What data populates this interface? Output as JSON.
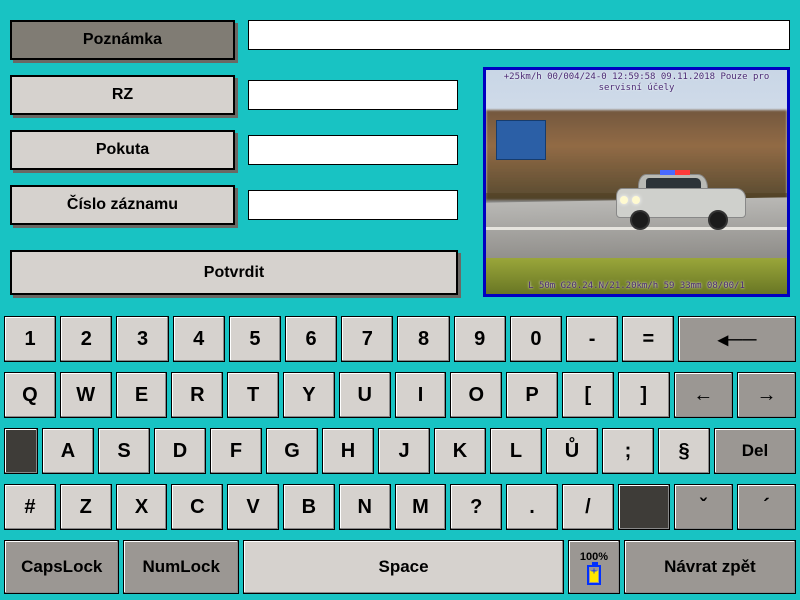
{
  "form": {
    "poznamka_label": "Poznámka",
    "rz_label": "RZ",
    "pokuta_label": "Pokuta",
    "cislo_zaznamu_label": "Číslo záznamu",
    "potvrdit_label": "Potvrdit",
    "poznamka_value": "",
    "rz_value": "",
    "pokuta_value": "",
    "cislo_zaznamu_value": ""
  },
  "photo": {
    "overlay_top": "+25km/h  00/004/24-0  12:59:58  09.11.2018\nPouze pro servisní účely",
    "overlay_bottom": "L 50m  G20.24.N/21.20km/h  59  33mm 08/00/1"
  },
  "battery": {
    "percent_label": "100%"
  },
  "keyboard": {
    "row1": [
      "1",
      "2",
      "3",
      "4",
      "5",
      "6",
      "7",
      "8",
      "9",
      "0",
      "-",
      "="
    ],
    "row1_back_glyph": "◂──",
    "row2": [
      "Q",
      "W",
      "E",
      "R",
      "T",
      "Y",
      "U",
      "I",
      "O",
      "P",
      "[",
      "]"
    ],
    "row2_left": "←",
    "row2_right": "→",
    "row3": [
      "A",
      "S",
      "D",
      "F",
      "G",
      "H",
      "J",
      "K",
      "L",
      "Ů",
      ";",
      "§"
    ],
    "row3_del": "Del",
    "row4": [
      "#",
      "Z",
      "X",
      "C",
      "V",
      "B",
      "N",
      "M",
      "?",
      ".",
      "/"
    ],
    "row4_accent1": "ˇ",
    "row4_accent2": "´",
    "row5_caps": "CapsLock",
    "row5_num": "NumLock",
    "row5_space": "Space",
    "row5_return": "Návrat zpět"
  }
}
